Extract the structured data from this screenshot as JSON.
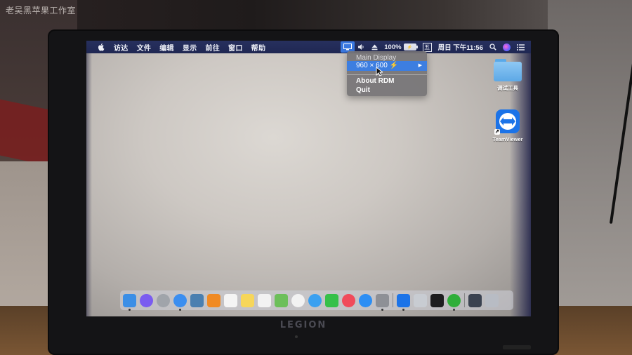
{
  "photo": {
    "watermark": "老吴黑苹果工作室",
    "laptop_brand": "LEGION"
  },
  "menubar": {
    "apple_icon": "apple-logo-icon",
    "menus": [
      "访达",
      "文件",
      "编辑",
      "显示",
      "前往",
      "窗口",
      "帮助"
    ],
    "status": {
      "display_icon": "display-icon",
      "volume_icon": "speaker-icon",
      "eject_icon": "eject-icon",
      "battery_percent": "100%",
      "battery_icon": "battery-charging-icon",
      "input_method": "五",
      "clock": "周日 下午11:56",
      "search_icon": "spotlight-search-icon",
      "siri_icon": "siri-icon",
      "notification_icon": "notification-center-icon"
    }
  },
  "rdm_menu": {
    "header": "Main Display",
    "selected_resolution": "960 × 600",
    "lightning": "⚡",
    "submenu_arrow": "▶",
    "about": "About RDM",
    "quit": "Quit"
  },
  "desktop_icons": [
    {
      "label": "调试工具",
      "icon": "folder-icon"
    },
    {
      "label": "TeamViewer",
      "icon": "teamviewer-icon"
    }
  ],
  "dock": {
    "apps": [
      {
        "name": "finder",
        "color": "#3a8ee6",
        "running": true
      },
      {
        "name": "siri",
        "color": "#7a5cf0",
        "round": true
      },
      {
        "name": "launchpad",
        "color": "#a0a4aa",
        "round": true
      },
      {
        "name": "safari",
        "color": "#3b8ef0",
        "round": true,
        "running": true
      },
      {
        "name": "preview-photo",
        "color": "#4a7fb0"
      },
      {
        "name": "ibooks",
        "color": "#f08a24"
      },
      {
        "name": "calendar",
        "color": "#f4f4f4"
      },
      {
        "name": "notes",
        "color": "#f6d65a"
      },
      {
        "name": "reminders",
        "color": "#f2f2f2"
      },
      {
        "name": "maps",
        "color": "#6cbf5a"
      },
      {
        "name": "photos",
        "color": "#f2f2f2",
        "round": true
      },
      {
        "name": "messages",
        "color": "#3aa0f0",
        "round": true
      },
      {
        "name": "facetime",
        "color": "#36c04a"
      },
      {
        "name": "music",
        "color": "#f04a5a",
        "round": true
      },
      {
        "name": "app-store",
        "color": "#2c8ef4",
        "round": true
      },
      {
        "name": "system-preferences",
        "color": "#8e9096",
        "running": true
      },
      {
        "name": "teamviewer",
        "color": "#1b73e8",
        "running": true
      },
      {
        "name": "network-utility",
        "color": "#c8ccd2"
      },
      {
        "name": "terminal",
        "color": "#1d1d1f"
      },
      {
        "name": "green-app",
        "color": "#2fae3a",
        "round": true,
        "running": true
      },
      {
        "name": "downloads-stack",
        "color": "#3a4250"
      },
      {
        "name": "trash",
        "color": "#b8bcc4"
      }
    ]
  }
}
